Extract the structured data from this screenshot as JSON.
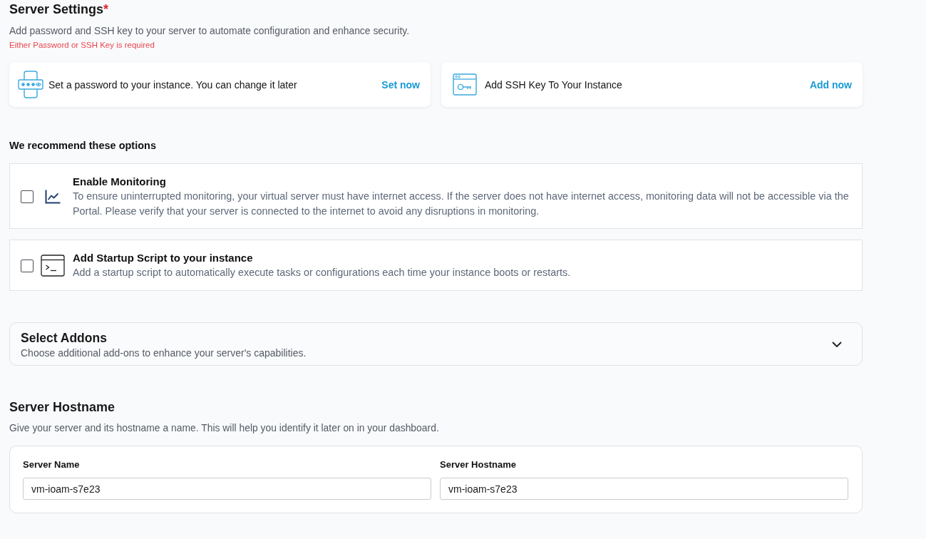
{
  "header": {
    "title": "Server Settings",
    "required_mark": "*",
    "description": "Add password and SSH key to your server to automate configuration and enhance security.",
    "error": "Either Password or SSH Key is required"
  },
  "credential_options": [
    {
      "kind": "password",
      "text": "Set a password to your instance. You can change it later",
      "action": "Set now"
    },
    {
      "kind": "ssh_key",
      "text": "Add SSH Key To Your Instance",
      "action": "Add now"
    }
  ],
  "recommendations": {
    "title": "We recommend these options",
    "options": [
      {
        "kind": "monitoring",
        "title": "Enable Monitoring",
        "description": "To ensure uninterrupted monitoring, your virtual server must have internet access. If the server does not have internet access, monitoring data will not be accessible via the Portal. Please verify that your server is connected to the internet to avoid any disruptions in monitoring.",
        "checked": false
      },
      {
        "kind": "startup_script",
        "title": "Add Startup Script to your instance",
        "description": "Add a startup script to automatically execute tasks or configurations each time your instance boots or restarts.",
        "checked": false
      }
    ]
  },
  "addons": {
    "title": "Select Addons",
    "description": "Choose additional add-ons to enhance your server's capabilities.",
    "expanded": false
  },
  "hostname": {
    "title": "Server Hostname",
    "description": "Give your server and its hostname a name. This will help you identify it later on in your dashboard.",
    "fields": [
      {
        "label": "Server Name",
        "value": "vm-ioam-s7e23"
      },
      {
        "label": "Server Hostname",
        "value": "vm-ioam-s7e23"
      }
    ]
  }
}
